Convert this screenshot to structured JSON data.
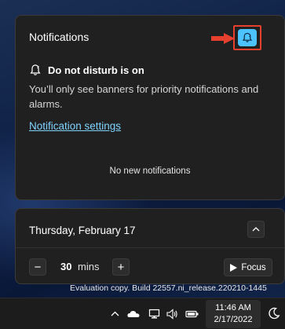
{
  "notifications": {
    "title": "Notifications",
    "dnd_heading": "Do not disturb is on",
    "dnd_body": "You’ll only see banners for priority notifications and alarms.",
    "settings_link": "Notification settings",
    "empty_text": "No new notifications",
    "toggle_icon": "do-not-disturb-icon",
    "accent_color": "#4cc2ff",
    "highlight_color": "#e8402e"
  },
  "calendar": {
    "date_label": "Thursday, February 17",
    "collapse_icon": "chevron-up-icon"
  },
  "focus": {
    "minutes_value": "30",
    "minutes_unit": "mins",
    "minus_label": "−",
    "plus_label": "+",
    "button_label": "Focus"
  },
  "desktop": {
    "watermark": "Evaluation copy. Build 22557.ni_release.220210-1445"
  },
  "taskbar": {
    "time": "11:46 AM",
    "date": "2/17/2022",
    "icons": [
      "chevron-up-icon",
      "onedrive-cloud-icon",
      "network-icon",
      "volume-icon",
      "battery-icon",
      "quiet-hours-moon-icon"
    ]
  }
}
